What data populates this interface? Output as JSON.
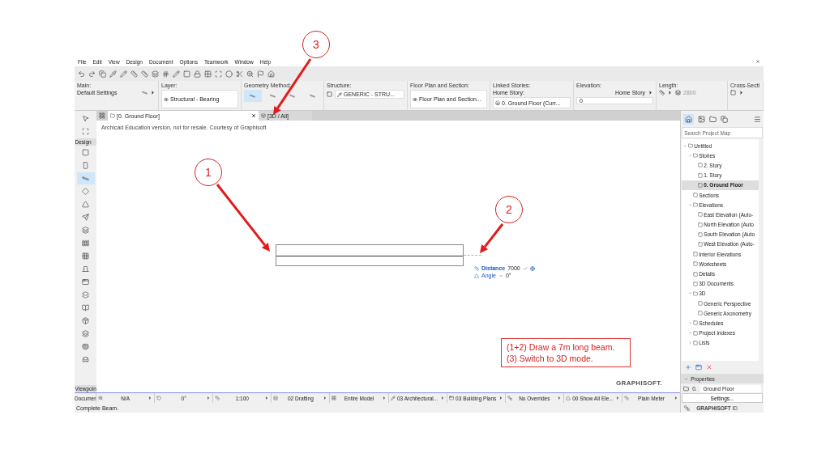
{
  "menu": [
    "File",
    "Edit",
    "View",
    "Design",
    "Document",
    "Options",
    "Teamwork",
    "Window",
    "Help"
  ],
  "info_box": [
    {
      "kind": "settings",
      "label": "Main:",
      "value": "Default Settings"
    },
    {
      "kind": "dropdown",
      "label": "Layer:",
      "value": "Structural - Bearing"
    },
    {
      "kind": "methods",
      "label": "Geometry Method:"
    },
    {
      "kind": "structure",
      "label": "Structure:",
      "value": "GENERIC - STRU..."
    },
    {
      "kind": "dropdown",
      "label": "Floor Plan and Section:",
      "value": "Floor Plan and Section..."
    },
    {
      "kind": "story",
      "label": "Linked Stories:",
      "sublabel": "Home Story:",
      "value": "0. Ground Floor (Curr..."
    },
    {
      "kind": "elevation",
      "label": "Elevation:",
      "sublabel": "Home Story",
      "value": "0"
    },
    {
      "kind": "length",
      "label": "Length:",
      "value": "2800"
    },
    {
      "kind": "cross",
      "label": "Cross-Secti"
    }
  ],
  "tabs": [
    {
      "label": "[0. Ground Floor]",
      "selected": true,
      "closable": true
    },
    {
      "label": "[3D / All]",
      "selected": false,
      "closable": false
    }
  ],
  "notice": "Archicad Education version, not for resale. Courtesy of Graphisoft",
  "toolbox": {
    "section": "Design",
    "footer": "Viewpoin",
    "tools": [
      {
        "selected": false
      },
      {
        "selected": false
      },
      {
        "selected": true
      },
      {
        "selected": false
      },
      {
        "selected": false
      },
      {
        "selected": false
      },
      {
        "selected": false
      },
      {
        "selected": false
      },
      {
        "selected": false
      },
      {
        "selected": false
      },
      {
        "selected": false
      },
      {
        "selected": false
      },
      {
        "selected": false
      },
      {
        "selected": false
      },
      {
        "selected": false
      },
      {
        "selected": false
      },
      {
        "selected": false
      }
    ]
  },
  "canvas": {
    "tracker": {
      "distance_label": "Distance",
      "distance": "7000",
      "angle_label": "Angle",
      "angle": "0°"
    },
    "logo": "GRAPHISOFT."
  },
  "quick_options": {
    "label": "Documer",
    "items": [
      "N/A",
      "0°",
      "1:100",
      "02 Drafting",
      "Entire Model",
      "03 Architectural...",
      "03 Building Plans",
      "No Overrides",
      "00 Show All Ele...",
      "Plain Meter"
    ]
  },
  "status": "Complete Beam.",
  "navigator": {
    "search": {
      "placeholder": "Search Project Map"
    },
    "tree": [
      {
        "label": "Untitled",
        "expanded": true,
        "selected": false,
        "children": [
          {
            "label": "Stories",
            "expanded": true,
            "selected": false,
            "children": [
              {
                "label": "2. Story",
                "selected": false
              },
              {
                "label": "1. Story",
                "selected": false
              },
              {
                "label": "0. Ground Floor",
                "selected": true
              }
            ]
          },
          {
            "label": "Sections",
            "selected": false
          },
          {
            "label": "Elevations",
            "expanded": true,
            "selected": false,
            "children": [
              {
                "label": "East Elevation (Auto-",
                "selected": false
              },
              {
                "label": "North Elevation (Auto",
                "selected": false
              },
              {
                "label": "South Elevation (Auto",
                "selected": false
              },
              {
                "label": "West Elevation (Auto-",
                "selected": false
              }
            ]
          },
          {
            "label": "Interior Elevations",
            "selected": false
          },
          {
            "label": "Worksheets",
            "selected": false
          },
          {
            "label": "Details",
            "selected": false
          },
          {
            "label": "3D Documents",
            "selected": false
          },
          {
            "label": "3D",
            "expanded": true,
            "selected": false,
            "children": [
              {
                "label": "Generic Perspective",
                "selected": false
              },
              {
                "label": "Generic Axonometry",
                "selected": false
              }
            ]
          },
          {
            "label": "Schedules",
            "expanded": false,
            "selected": false
          },
          {
            "label": "Project Indexes",
            "expanded": false,
            "selected": false
          },
          {
            "label": "Lists",
            "expanded": false,
            "selected": false
          }
        ]
      }
    ],
    "properties": {
      "title": "Properties",
      "story_number": "0.",
      "story_name": "Ground Floor",
      "button": "Settings..."
    },
    "id_label": "**GRAPHISOFT** ID"
  },
  "annotations": {
    "callouts": [
      "1",
      "2",
      "3"
    ],
    "note": [
      "(1+2) Draw a 7m long beam.",
      "(3) Switch to 3D mode."
    ]
  }
}
